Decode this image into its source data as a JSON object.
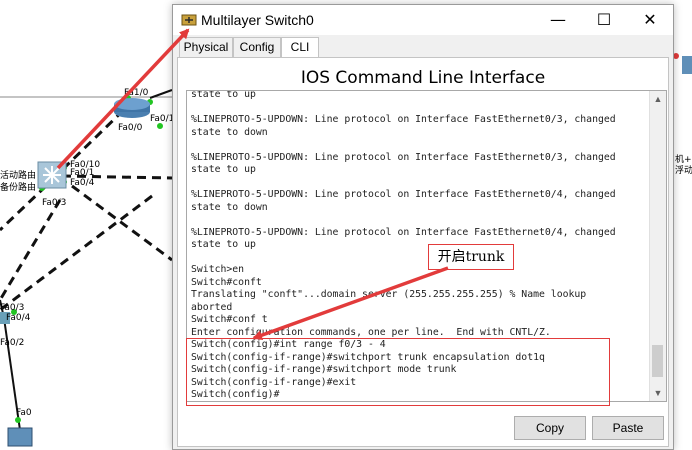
{
  "window": {
    "title": "Multilayer Switch0",
    "minimize_glyph": "—",
    "maximize_glyph": "☐",
    "close_glyph": "✕",
    "icon": "switch-icon"
  },
  "tabs": [
    "Physical",
    "Config",
    "CLI"
  ],
  "active_tab": "CLI",
  "cli": {
    "heading": "IOS Command Line Interface",
    "lines": [
      "state to up",
      "",
      "%LINEPROTO-5-UPDOWN: Line protocol on Interface FastEthernet0/3, changed",
      "state to down",
      "",
      "%LINEPROTO-5-UPDOWN: Line protocol on Interface FastEthernet0/3, changed",
      "state to up",
      "",
      "%LINEPROTO-5-UPDOWN: Line protocol on Interface FastEthernet0/4, changed",
      "state to down",
      "",
      "%LINEPROTO-5-UPDOWN: Line protocol on Interface FastEthernet0/4, changed",
      "state to up",
      "",
      "Switch>en",
      "Switch#conft",
      "Translating \"conft\"...domain server (255.255.255.255) % Name lookup",
      "aborted",
      "Switch#conf t",
      "Enter configuration commands, one per line.  End with CNTL/Z.",
      "Switch(config)#int range f0/3 - 4",
      "Switch(config-if-range)#switchport trunk encapsulation dot1q",
      "Switch(config-if-range)#switchport mode trunk",
      "Switch(config-if-range)#exit",
      "Switch(config)#"
    ],
    "copy_label": "Copy",
    "paste_label": "Paste"
  },
  "annotation": {
    "label": "开启trunk",
    "color": "#e23b3b"
  },
  "topology": {
    "labels": [
      "Fa1/0",
      "Fa0/0",
      "Fa0/1",
      "Fa0/10",
      "Fa0/1",
      "Fa0/4",
      "Fa0/3",
      "Fa0/3",
      "Fa0/4",
      "Fa0/2",
      "Fa0"
    ],
    "zh_labels": [
      "活动路由",
      "备份路由",
      "机+",
      "浮动"
    ]
  }
}
